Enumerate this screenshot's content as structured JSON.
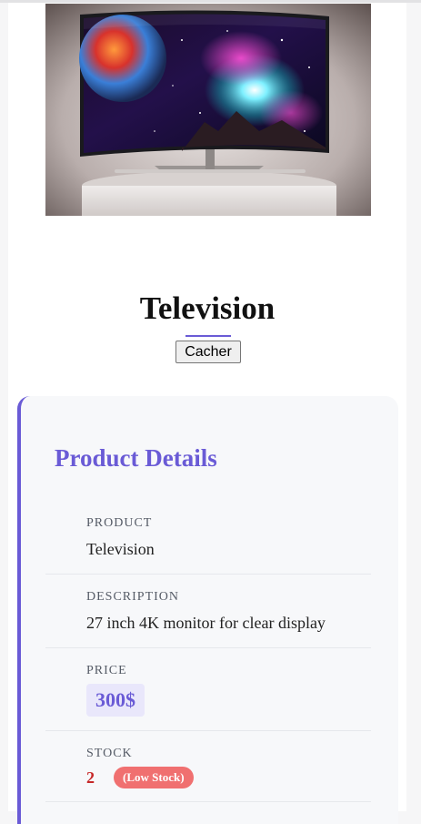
{
  "product": {
    "title": "Television",
    "hide_button_label": "Cacher",
    "image_alt": "television-product-image"
  },
  "details": {
    "heading": "Product Details",
    "fields": {
      "product_label": "PRODUCT",
      "product_value": "Television",
      "description_label": "DESCRIPTION",
      "description_value": "27 inch 4K monitor for clear display",
      "price_label": "PRICE",
      "price_value": "300$",
      "stock_label": "STOCK",
      "stock_value": "2",
      "stock_status": "(Low Stock)"
    }
  },
  "colors": {
    "accent": "#6a5bd6",
    "low_stock_badge": "#f07070",
    "stock_number": "#c62828",
    "price_bg": "#e9e7fb"
  }
}
